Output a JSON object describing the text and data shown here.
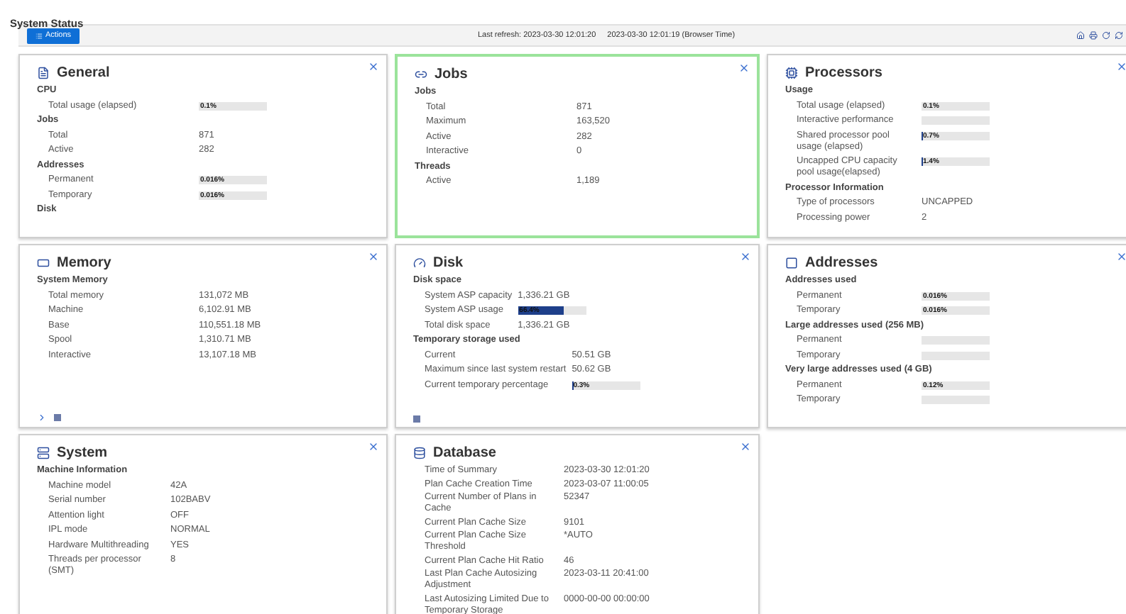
{
  "page_title": "System Status",
  "toolbar": {
    "actions_button": "Actions",
    "refresh": "Last refresh: 2023-03-30 12:01:20",
    "browser_time": "2023-03-30 12:01:19 (Browser Time)"
  },
  "cards": [
    {
      "kind": "general",
      "title": "General",
      "selected": false,
      "sections": [
        {
          "heading": "CPU",
          "rows": [
            {
              "kind": "bar",
              "label": "Total usage (elapsed)",
              "reading": "0.1%",
              "level": 0.001
            }
          ]
        },
        {
          "heading": "Jobs",
          "rows": [
            {
              "kind": "value",
              "label": "Total",
              "value": "871"
            },
            {
              "kind": "value",
              "label": "Active",
              "value": "282"
            }
          ]
        },
        {
          "heading": "Addresses",
          "rows": [
            {
              "kind": "bar",
              "label": "Permanent",
              "reading": "0.016%",
              "level": 0.00016
            },
            {
              "kind": "bar",
              "label": "Temporary",
              "reading": "0.016%",
              "level": 0.00016
            }
          ]
        },
        {
          "heading": "Disk"
        }
      ]
    },
    {
      "kind": "jobs",
      "title": "Jobs",
      "selected": true,
      "sections": [
        {
          "heading": "Jobs",
          "rows": [
            {
              "kind": "value",
              "label": "Total",
              "value": "871"
            },
            {
              "kind": "value",
              "label": "Maximum",
              "value": "163,520"
            },
            {
              "kind": "value",
              "label": "Active",
              "value": "282"
            },
            {
              "kind": "value",
              "label": "Interactive",
              "value": "0"
            }
          ]
        },
        {
          "heading": "Threads",
          "rows": [
            {
              "kind": "value",
              "label": "Active",
              "value": "1,189"
            }
          ]
        }
      ]
    },
    {
      "kind": "processors",
      "title": "Processors",
      "selected": false,
      "sections": [
        {
          "heading": "Usage",
          "rows": [
            {
              "kind": "bar",
              "label": "Total usage (elapsed)",
              "reading": "0.1%",
              "level": 0.001
            },
            {
              "kind": "bar",
              "label": "Interactive performance",
              "level": 0
            },
            {
              "kind": "bar",
              "label": "Shared processor pool usage (elapsed)",
              "reading": "0.7%",
              "level": 0.007
            },
            {
              "kind": "bar",
              "label": "Uncapped CPU capacity pool usage(elapsed)",
              "reading": "1.4%",
              "level": 0.014
            }
          ]
        },
        {
          "heading": "Processor Information",
          "rows": [
            {
              "kind": "value",
              "label": "Type of processors",
              "value": "UNCAPPED"
            },
            {
              "kind": "value",
              "label": "Processing power",
              "value": "2"
            }
          ]
        }
      ]
    },
    {
      "kind": "memory",
      "title": "Memory",
      "selected": false,
      "sections": [
        {
          "heading": "System Memory",
          "rows": [
            {
              "kind": "value",
              "label": "Total memory",
              "value": "131,072 MB"
            }
          ]
        },
        {
          "rows": [
            {
              "kind": "value",
              "label": "Machine",
              "value": "6,102.91 MB"
            },
            {
              "kind": "value",
              "label": "Base",
              "value": "110,551.18 MB"
            },
            {
              "kind": "value",
              "label": "Spool",
              "value": "1,310.71 MB"
            },
            {
              "kind": "value",
              "label": "Interactive",
              "value": "13,107.18 MB"
            }
          ]
        }
      ],
      "footer": [
        {
          "kind": "chevron"
        },
        {
          "kind": "square"
        }
      ]
    },
    {
      "kind": "disk",
      "title": "Disk",
      "selected": false,
      "sections": [
        {
          "heading": "Disk space",
          "rows": [
            {
              "kind": "value",
              "label": "System ASP capacity",
              "value": "1,336.21 GB"
            },
            {
              "kind": "bar",
              "label": "System ASP usage",
              "reading": "66.4%",
              "level": 0.664
            },
            {
              "kind": "value",
              "label": "Total disk space",
              "value": "1,336.21 GB"
            }
          ]
        },
        {
          "heading": "Temporary storage used",
          "rows": [
            {
              "kind": "value",
              "label": "Current",
              "value": "50.51 GB"
            },
            {
              "kind": "value",
              "label": "Maximum since last system restart",
              "value": "50.62 GB"
            },
            {
              "kind": "bar",
              "label": "Current temporary percentage",
              "reading": "0.3%",
              "level": 0.003
            }
          ]
        }
      ],
      "footer": [
        {
          "kind": "square"
        }
      ]
    },
    {
      "kind": "addresses",
      "title": "Addresses",
      "selected": false,
      "sections": [
        {
          "heading": "Addresses used",
          "rows": [
            {
              "kind": "bar",
              "label": "Permanent",
              "reading": "0.016%",
              "level": 0.00016
            },
            {
              "kind": "bar",
              "label": "Temporary",
              "reading": "0.016%",
              "level": 0.00016
            }
          ]
        },
        {
          "heading": "Large addresses used (256 MB)",
          "rows": [
            {
              "kind": "bar",
              "label": "Permanent",
              "level": 0
            },
            {
              "kind": "bar",
              "label": "Temporary",
              "level": 0
            }
          ]
        },
        {
          "heading": "Very large addresses used (4 GB)",
          "rows": [
            {
              "kind": "bar",
              "label": "Permanent",
              "reading": "0.12%",
              "level": 0.0012
            },
            {
              "kind": "bar",
              "label": "Temporary",
              "level": 0
            }
          ]
        }
      ]
    },
    {
      "kind": "system",
      "title": "System",
      "selected": false,
      "sections": [
        {
          "heading": "Machine Information",
          "rows": [
            {
              "kind": "value",
              "label": "Machine model",
              "value": "42A"
            },
            {
              "kind": "value",
              "label": "Serial number",
              "value": "102BABV"
            },
            {
              "kind": "value",
              "label": "Attention light",
              "value": "OFF"
            },
            {
              "kind": "value",
              "label": "IPL mode",
              "value": "NORMAL"
            },
            {
              "kind": "value",
              "label": "Hardware Multithreading",
              "value": "YES"
            },
            {
              "kind": "value",
              "label": "Threads per processor (SMT)",
              "value": "8"
            }
          ]
        }
      ]
    },
    {
      "kind": "database",
      "title": "Database",
      "selected": false,
      "sections": [
        {
          "rows": [
            {
              "kind": "value",
              "label": "Time of Summary",
              "value": "2023-03-30 12:01:20"
            },
            {
              "kind": "value",
              "label": "Plan Cache Creation Time",
              "value": "2023-03-07 11:00:05"
            },
            {
              "kind": "value",
              "label": "Current Number of Plans in Cache",
              "value": "52347"
            },
            {
              "kind": "value",
              "label": "Current Plan Cache Size",
              "value": "9101"
            },
            {
              "kind": "value",
              "label": "Current Plan Cache Size Threshold",
              "value": "*AUTO"
            },
            {
              "kind": "value",
              "label": "Current Plan Cache Hit Ratio",
              "value": "46"
            },
            {
              "kind": "value",
              "label": "Last Plan Cache Autosizing Adjustment",
              "value": "2023-03-11 20:41:00"
            },
            {
              "kind": "value",
              "label": "Last Autosizing Limited Due to Temporary Storage",
              "value": "0000-00-00 00:00:00"
            }
          ]
        }
      ]
    }
  ]
}
